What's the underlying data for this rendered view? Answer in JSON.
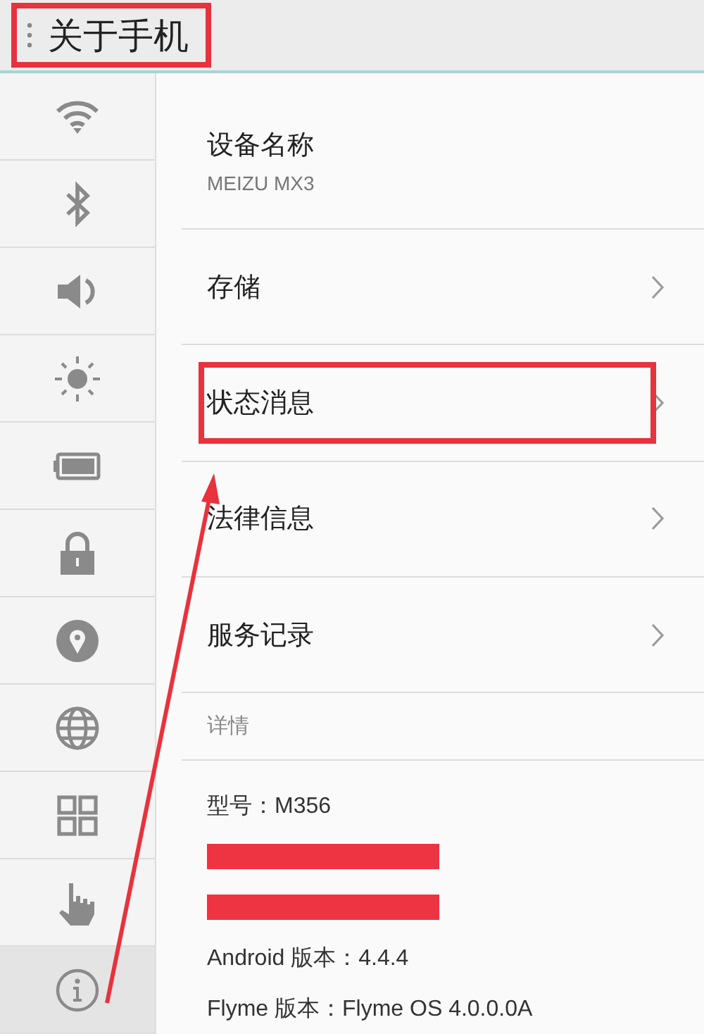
{
  "header": {
    "title": "关于手机",
    "highlighted": true
  },
  "sidebar": {
    "items": [
      {
        "kind": "wifi",
        "selected": false
      },
      {
        "kind": "bluetooth",
        "selected": false
      },
      {
        "kind": "sound",
        "selected": false
      },
      {
        "kind": "brightness",
        "selected": false
      },
      {
        "kind": "battery",
        "selected": false
      },
      {
        "kind": "lock",
        "selected": false
      },
      {
        "kind": "location",
        "selected": false
      },
      {
        "kind": "globe",
        "selected": false
      },
      {
        "kind": "apps",
        "selected": false
      },
      {
        "kind": "hand",
        "selected": false
      },
      {
        "kind": "info",
        "selected": true
      }
    ]
  },
  "device": {
    "label": "设备名称",
    "value": "MEIZU MX3"
  },
  "menu": [
    {
      "label": "存储",
      "highlighted": false
    },
    {
      "label": "状态消息",
      "highlighted": true
    },
    {
      "label": "法律信息",
      "highlighted": false
    },
    {
      "label": "服务记录",
      "highlighted": false
    }
  ],
  "details": {
    "heading": "详情",
    "lines": [
      {
        "kind": "text",
        "text": "型号：M356"
      },
      {
        "kind": "redacted"
      },
      {
        "kind": "redacted"
      },
      {
        "kind": "text",
        "text": "Android 版本：4.4.4"
      },
      {
        "kind": "text",
        "text": "Flyme 版本：Flyme OS 4.0.0.0A"
      }
    ]
  },
  "arrow": true
}
